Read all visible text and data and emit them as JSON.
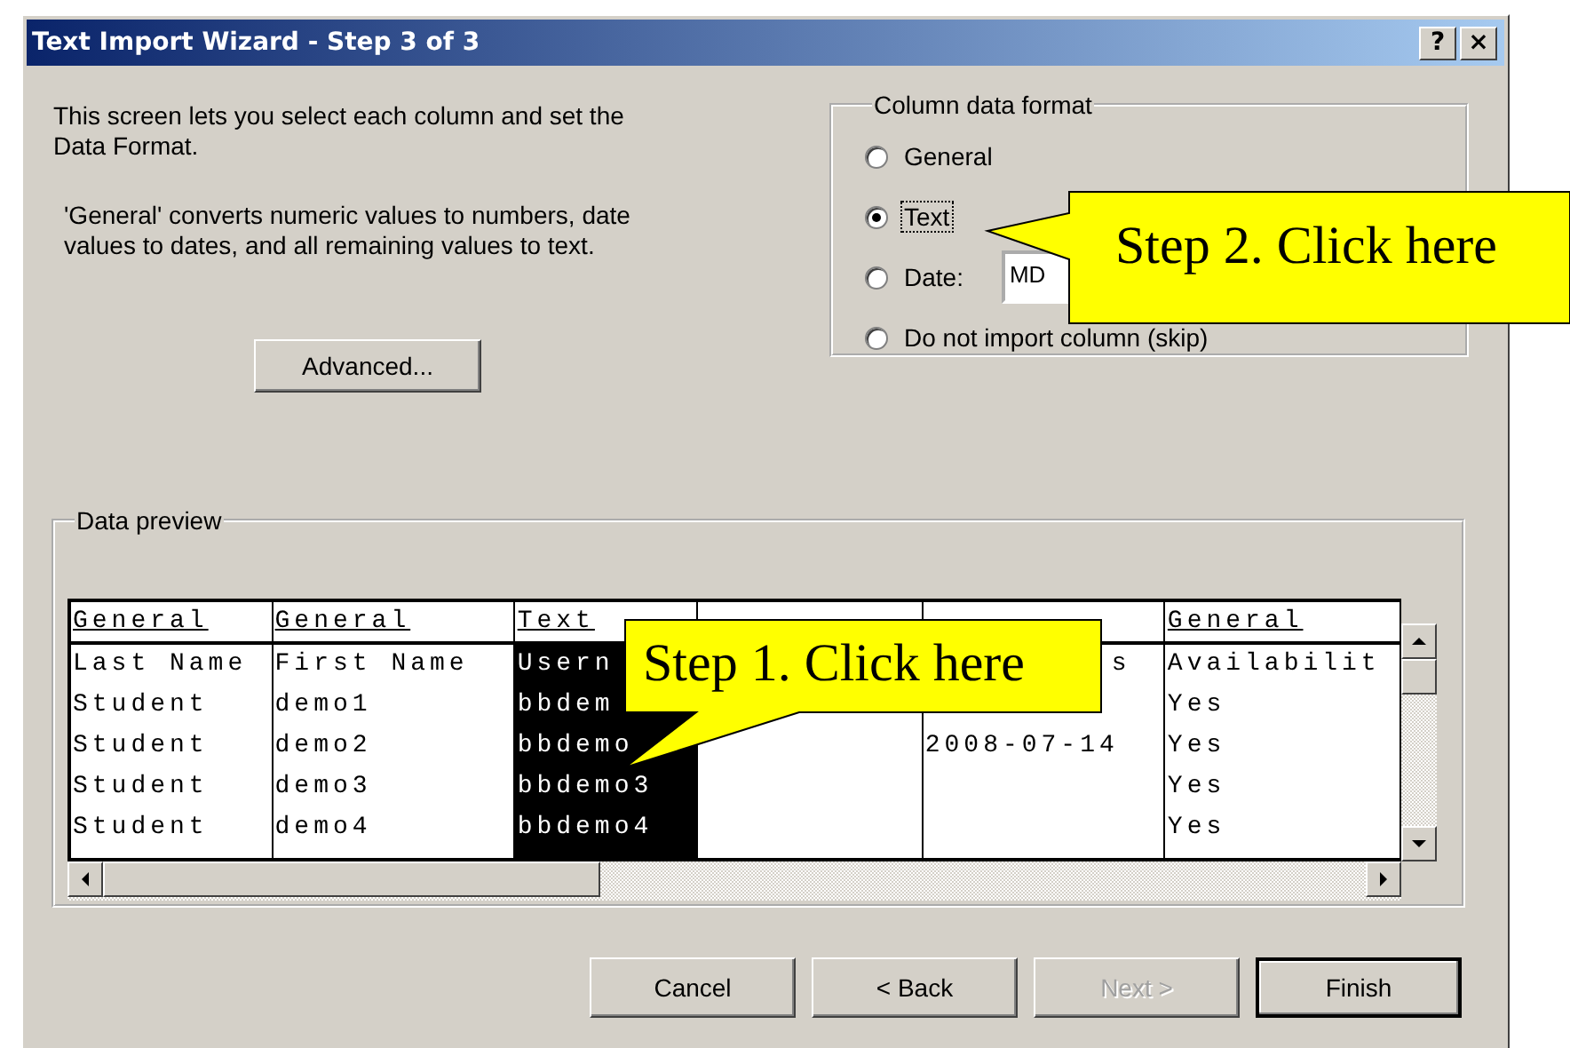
{
  "window": {
    "title": "Text Import Wizard - Step 3 of 3",
    "help_button": "?",
    "close_button": "×"
  },
  "intro": "This screen lets you select each column and set the Data Format.",
  "note": "'General' converts numeric values to numbers, date values to dates, and all remaining values to text.",
  "advanced_button": "Advanced...",
  "column_data_format": {
    "title": "Column data format",
    "options": [
      {
        "label": "General",
        "selected": false
      },
      {
        "label": "Text",
        "selected": true
      },
      {
        "label": "Date:",
        "selected": false,
        "date_format": "MD"
      },
      {
        "label": "Do not import column (skip)",
        "selected": false
      }
    ]
  },
  "data_preview": {
    "title": "Data preview",
    "columns": [
      {
        "header": "General",
        "selected": false
      },
      {
        "header": "General",
        "selected": false
      },
      {
        "header": "Text",
        "selected": true
      },
      {},
      {
        "selected": false
      },
      {
        "header": "General",
        "selected": false
      }
    ],
    "rows": [
      [
        "Last Name",
        "First Name",
        "Usern",
        null,
        "s",
        "Availabilit"
      ],
      [
        "Student",
        "demo1",
        "bbdem",
        null,
        null,
        "Yes"
      ],
      [
        "Student",
        "demo2",
        "bbdemo",
        null,
        "2008-07-14",
        "Yes"
      ],
      [
        "Student",
        "demo3",
        "bbdemo3",
        null,
        null,
        "Yes"
      ],
      [
        "Student",
        "demo4",
        "bbdemo4",
        null,
        null,
        "Yes"
      ]
    ]
  },
  "buttons": [
    {
      "label": "Cancel",
      "disabled": false,
      "default": false
    },
    {
      "label": "< Back",
      "disabled": false,
      "default": false
    },
    {
      "label": "Next >",
      "disabled": true,
      "default": false
    },
    {
      "label": "Finish",
      "disabled": false,
      "default": true
    }
  ],
  "callouts": [
    {
      "text": "Step 1. Click here"
    },
    {
      "text": "Step 2. Click here"
    }
  ]
}
